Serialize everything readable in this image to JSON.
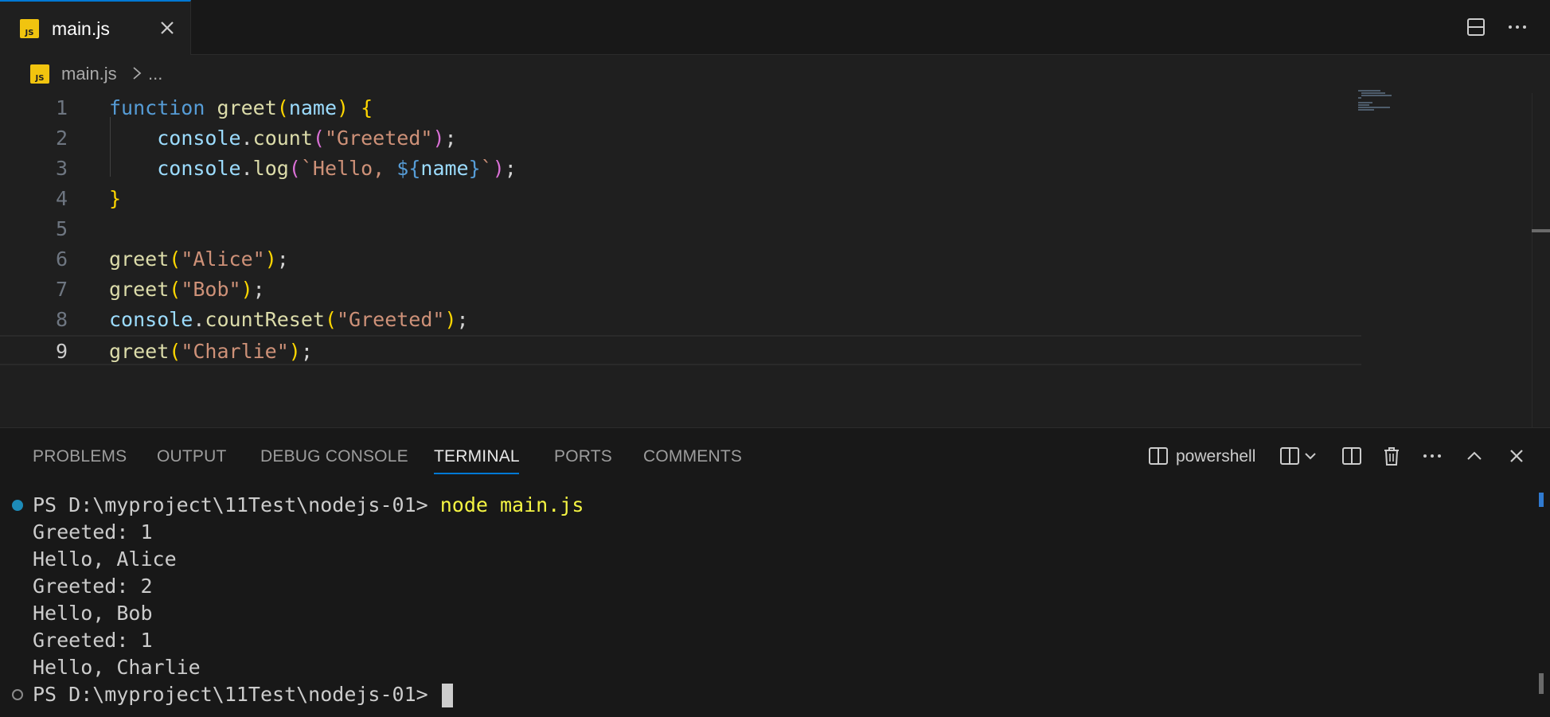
{
  "tab": {
    "label": "main.js",
    "icon_text": "JS"
  },
  "breadcrumb": {
    "file": "main.js",
    "more": "..."
  },
  "editor": {
    "lines": [
      {
        "n": "1",
        "tokens": [
          [
            "kw",
            "function"
          ],
          [
            "plain",
            " "
          ],
          [
            "fn",
            "greet"
          ],
          [
            "br1",
            "("
          ],
          [
            "param",
            "name"
          ],
          [
            "br1",
            ")"
          ],
          [
            "plain",
            " "
          ],
          [
            "br1",
            "{"
          ]
        ]
      },
      {
        "n": "2",
        "tokens": [
          [
            "plain",
            "    "
          ],
          [
            "var",
            "console"
          ],
          [
            "plain",
            "."
          ],
          [
            "fn",
            "count"
          ],
          [
            "br2",
            "("
          ],
          [
            "str",
            "\"Greeted\""
          ],
          [
            "br2",
            ")"
          ],
          [
            "plain",
            ";"
          ]
        ]
      },
      {
        "n": "3",
        "tokens": [
          [
            "plain",
            "    "
          ],
          [
            "var",
            "console"
          ],
          [
            "plain",
            "."
          ],
          [
            "fn",
            "log"
          ],
          [
            "br2",
            "("
          ],
          [
            "str",
            "`Hello, "
          ],
          [
            "kw",
            "${"
          ],
          [
            "param",
            "name"
          ],
          [
            "kw",
            "}"
          ],
          [
            "str",
            "`"
          ],
          [
            "br2",
            ")"
          ],
          [
            "plain",
            ";"
          ]
        ]
      },
      {
        "n": "4",
        "tokens": [
          [
            "br1",
            "}"
          ]
        ]
      },
      {
        "n": "5",
        "tokens": []
      },
      {
        "n": "6",
        "tokens": [
          [
            "fn",
            "greet"
          ],
          [
            "br1",
            "("
          ],
          [
            "str",
            "\"Alice\""
          ],
          [
            "br1",
            ")"
          ],
          [
            "plain",
            ";"
          ]
        ]
      },
      {
        "n": "7",
        "tokens": [
          [
            "fn",
            "greet"
          ],
          [
            "br1",
            "("
          ],
          [
            "str",
            "\"Bob\""
          ],
          [
            "br1",
            ")"
          ],
          [
            "plain",
            ";"
          ]
        ]
      },
      {
        "n": "8",
        "tokens": [
          [
            "var",
            "console"
          ],
          [
            "plain",
            "."
          ],
          [
            "fn",
            "countReset"
          ],
          [
            "br1",
            "("
          ],
          [
            "str",
            "\"Greeted\""
          ],
          [
            "br1",
            ")"
          ],
          [
            "plain",
            ";"
          ]
        ]
      },
      {
        "n": "9",
        "tokens": [
          [
            "fn",
            "greet"
          ],
          [
            "br1",
            "("
          ],
          [
            "str",
            "\"Charlie\""
          ],
          [
            "br1",
            ")"
          ],
          [
            "plain",
            ";"
          ]
        ]
      }
    ],
    "active_line": "9"
  },
  "panel": {
    "tabs": [
      "PROBLEMS",
      "OUTPUT",
      "DEBUG CONSOLE",
      "TERMINAL",
      "PORTS",
      "COMMENTS"
    ],
    "active_tab": "TERMINAL",
    "shell": "powershell"
  },
  "terminal": {
    "prompt": "PS D:\\myproject\\11Test\\nodejs-01> ",
    "command": "node main.js",
    "output": [
      "Greeted: 1",
      "Hello, Alice",
      "Greeted: 2",
      "Hello, Bob",
      "Greeted: 1",
      "Hello, Charlie"
    ]
  },
  "colors": {
    "accent": "#0078d4",
    "js_icon": "#f1c40f",
    "command": "#f5f543"
  },
  "icons": {
    "tab_close": "close-icon",
    "layout": "split-editor-layout-icon",
    "more": "more-actions-icon",
    "terminal_shell": "terminal-split-icon",
    "trash": "trash-icon",
    "maximize": "chevron-up-icon",
    "close_panel": "close-icon"
  }
}
